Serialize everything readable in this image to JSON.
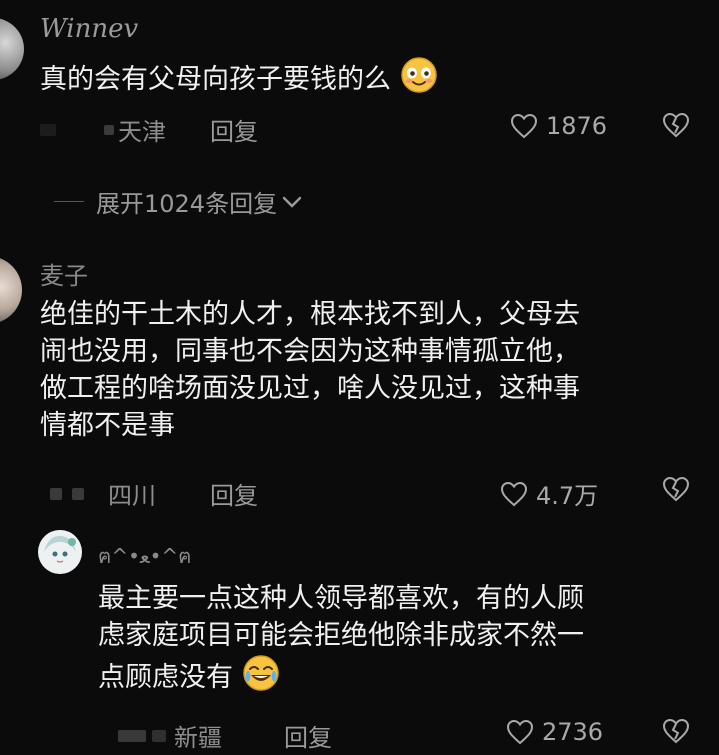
{
  "comments": [
    {
      "user": "Winnev",
      "text": "真的会有父母向孩子要钱的么",
      "location": "天津",
      "reply_label": "回复",
      "likes": "1876",
      "expand": "展开1024条回复"
    },
    {
      "user": "麦子",
      "text_lines": [
        "绝佳的干土木的人才，根本找不到人，父母去",
        "闹也没用，同事也不会因为这种事情孤立他，",
        "做工程的啥场面没见过，啥人没见过，这种事",
        "情都不是事"
      ],
      "location": "四川",
      "reply_label": "回复",
      "likes": "4.7万"
    },
    {
      "user": "ฅ^•ﻌ•^ฅ",
      "text_lines": [
        "最主要一点这种人领导都喜欢，有的人顾",
        "虑家庭项目可能会拒绝他除非成家不然一",
        "点顾虑没有"
      ],
      "location": "新疆",
      "reply_label": "回复",
      "likes": "2736"
    }
  ]
}
